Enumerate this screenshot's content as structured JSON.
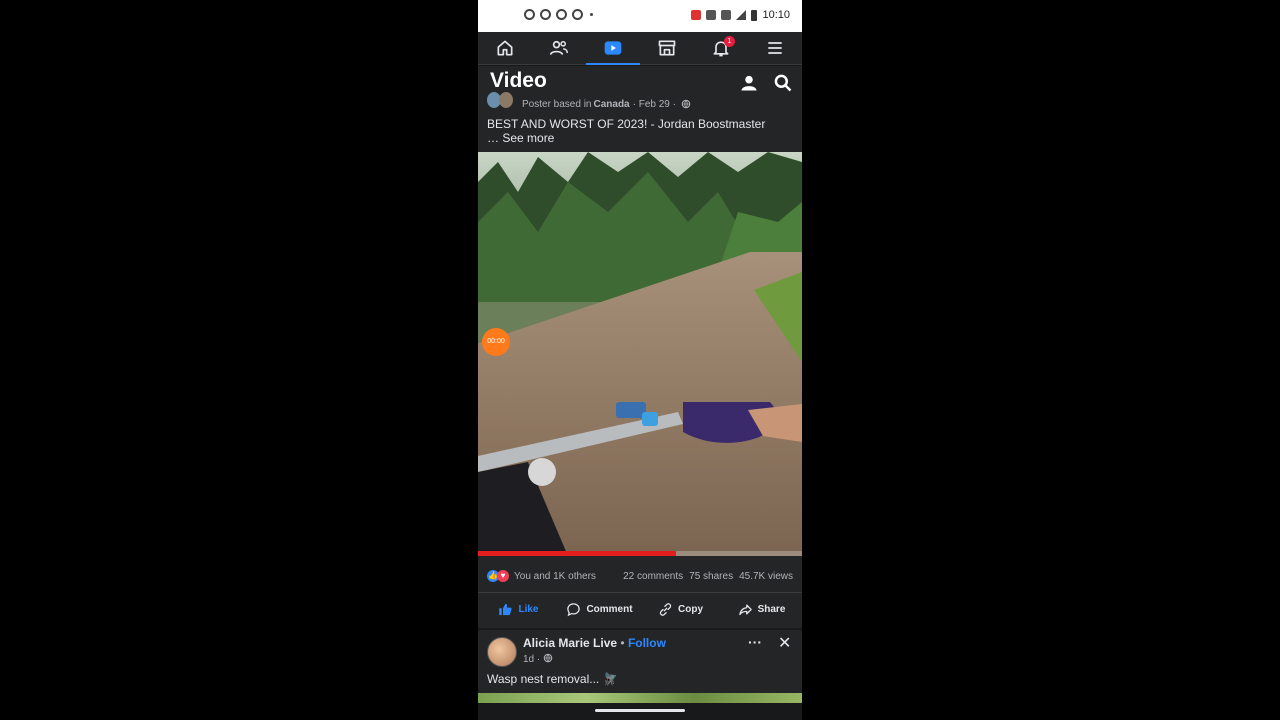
{
  "status_bar": {
    "time": "10:10"
  },
  "nav": {
    "items": [
      {
        "name": "home"
      },
      {
        "name": "friends"
      },
      {
        "name": "video",
        "active": true
      },
      {
        "name": "marketplace"
      },
      {
        "name": "notifications",
        "badge": "1"
      },
      {
        "name": "menu"
      }
    ]
  },
  "header": {
    "title": "Video"
  },
  "post1": {
    "meta_prefix": "Poster based in",
    "meta_location": "Canada",
    "meta_date": "· Feb 29 ·",
    "caption": "BEST AND WORST OF 2023! - Jordan Boostmaster",
    "see_more": "… See more",
    "video": {
      "timer": "00:00",
      "progress": 0.61
    },
    "reactions_text": "You and 1K others",
    "comments": "22 comments",
    "shares": "75 shares",
    "views": "45.7K views",
    "actions": {
      "like": "Like",
      "comment": "Comment",
      "copy": "Copy",
      "share": "Share"
    }
  },
  "post2": {
    "author": "Alicia Marie Live",
    "separator": "•",
    "follow": "Follow",
    "time": "1d ·",
    "more": "···",
    "close": "✕",
    "text": "Wasp nest removal... 🪰"
  },
  "colors": {
    "accent": "#2d88ff",
    "background": "#18191a",
    "surface": "#242526",
    "notification_badge": "#e41e3f",
    "progress": "#e41e1e"
  }
}
